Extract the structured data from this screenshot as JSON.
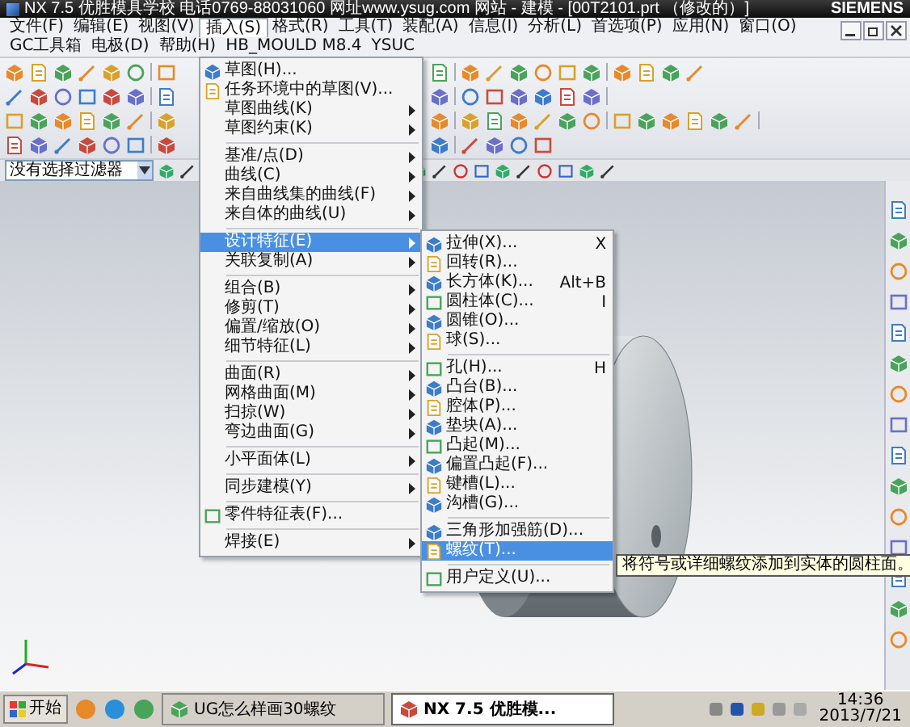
{
  "window": {
    "title": "NX 7.5 优胜模具学校 电话0769-88031060 网址www.ysug.com 网站 - 建模 - [00T2101.prt （修改的）]",
    "brand": "SIEMENS"
  },
  "menubar": [
    {
      "label": "文件(F)",
      "selected": false
    },
    {
      "label": "编辑(E)",
      "selected": false
    },
    {
      "label": "视图(V)",
      "selected": false
    },
    {
      "label": "插入(S)",
      "selected": true
    },
    {
      "label": "格式(R)",
      "selected": false
    },
    {
      "label": "工具(T)",
      "selected": false
    },
    {
      "label": "装配(A)",
      "selected": false
    },
    {
      "label": "信息(I)",
      "selected": false
    },
    {
      "label": "分析(L)",
      "selected": false
    },
    {
      "label": "首选项(P)",
      "selected": false
    },
    {
      "label": "应用(N)",
      "selected": false
    },
    {
      "label": "窗口(O)",
      "selected": false
    },
    {
      "label": "GC工具箱",
      "selected": false
    },
    {
      "label": "电极(D)",
      "selected": false
    },
    {
      "label": "帮助(H)",
      "selected": false
    },
    {
      "label": "HB_MOULD M8.4",
      "selected": false
    },
    {
      "label": "YSUC",
      "selected": false
    }
  ],
  "selection_bar": {
    "filter": "没有选择过滤器"
  },
  "insert_menu": [
    {
      "kind": "command",
      "label": "草图(H)...",
      "selected": false
    },
    {
      "kind": "command",
      "label": "任务环境中的草图(V)...",
      "selected": false
    },
    {
      "kind": "submenu",
      "label": "草图曲线(K)",
      "selected": false
    },
    {
      "kind": "submenu",
      "label": "草图约束(K)",
      "selected": false
    },
    {
      "kind": "separator"
    },
    {
      "kind": "submenu",
      "label": "基准/点(D)",
      "selected": false
    },
    {
      "kind": "submenu",
      "label": "曲线(C)",
      "selected": false
    },
    {
      "kind": "submenu",
      "label": "来自曲线集的曲线(F)",
      "selected": false
    },
    {
      "kind": "submenu",
      "label": "来自体的曲线(U)",
      "selected": false
    },
    {
      "kind": "separator"
    },
    {
      "kind": "submenu",
      "label": "设计特征(E)",
      "selected": true
    },
    {
      "kind": "submenu",
      "label": "关联复制(A)",
      "selected": false
    },
    {
      "kind": "separator"
    },
    {
      "kind": "submenu",
      "label": "组合(B)",
      "selected": false
    },
    {
      "kind": "submenu",
      "label": "修剪(T)",
      "selected": false
    },
    {
      "kind": "submenu",
      "label": "偏置/缩放(O)",
      "selected": false
    },
    {
      "kind": "submenu",
      "label": "细节特征(L)",
      "selected": false
    },
    {
      "kind": "separator"
    },
    {
      "kind": "submenu",
      "label": "曲面(R)",
      "selected": false
    },
    {
      "kind": "submenu",
      "label": "网格曲面(M)",
      "selected": false
    },
    {
      "kind": "submenu",
      "label": "扫掠(W)",
      "selected": false
    },
    {
      "kind": "submenu",
      "label": "弯边曲面(G)",
      "selected": false
    },
    {
      "kind": "separator"
    },
    {
      "kind": "submenu",
      "label": "小平面体(L)",
      "selected": false
    },
    {
      "kind": "separator"
    },
    {
      "kind": "submenu",
      "label": "同步建模(Y)",
      "selected": false
    },
    {
      "kind": "separator"
    },
    {
      "kind": "command",
      "label": "零件特征表(F)...",
      "selected": false
    },
    {
      "kind": "separator"
    },
    {
      "kind": "submenu",
      "label": "焊接(E)",
      "selected": false
    }
  ],
  "design_feature_menu": [
    {
      "kind": "command",
      "label": "拉伸(X)...",
      "shortcut": "X",
      "selected": false
    },
    {
      "kind": "command",
      "label": "回转(R)...",
      "selected": false
    },
    {
      "kind": "command",
      "label": "长方体(K)...",
      "shortcut": "Alt+B",
      "selected": false
    },
    {
      "kind": "command",
      "label": "圆柱体(C)...",
      "shortcut": "I",
      "selected": false
    },
    {
      "kind": "command",
      "label": "圆锥(O)...",
      "selected": false
    },
    {
      "kind": "command",
      "label": "球(S)...",
      "selected": false
    },
    {
      "kind": "separator"
    },
    {
      "kind": "command",
      "label": "孔(H)...",
      "shortcut": "H",
      "selected": false
    },
    {
      "kind": "command",
      "label": "凸台(B)...",
      "selected": false
    },
    {
      "kind": "command",
      "label": "腔体(P)...",
      "selected": false
    },
    {
      "kind": "command",
      "label": "垫块(A)...",
      "selected": false
    },
    {
      "kind": "command",
      "label": "凸起(M)...",
      "selected": false
    },
    {
      "kind": "command",
      "label": "偏置凸起(F)...",
      "selected": false
    },
    {
      "kind": "command",
      "label": "键槽(L)...",
      "selected": false
    },
    {
      "kind": "command",
      "label": "沟槽(G)...",
      "selected": false
    },
    {
      "kind": "separator"
    },
    {
      "kind": "command",
      "label": "三角形加强筋(D)...",
      "selected": false
    },
    {
      "kind": "command",
      "label": "螺纹(T)...",
      "selected": true
    },
    {
      "kind": "separator"
    },
    {
      "kind": "command",
      "label": "用户定义(U)...",
      "selected": false
    }
  ],
  "tooltip": {
    "text": "将符号或详细螺纹添加到实体的圆柱面。"
  },
  "taskbar": {
    "start": "开始",
    "tasks": [
      {
        "label": "UG怎么样画30螺纹",
        "selected": false
      },
      {
        "label": "NX 7.5 优胜模...",
        "selected": true
      }
    ],
    "time": "14:36",
    "date": "2013/7/21"
  }
}
